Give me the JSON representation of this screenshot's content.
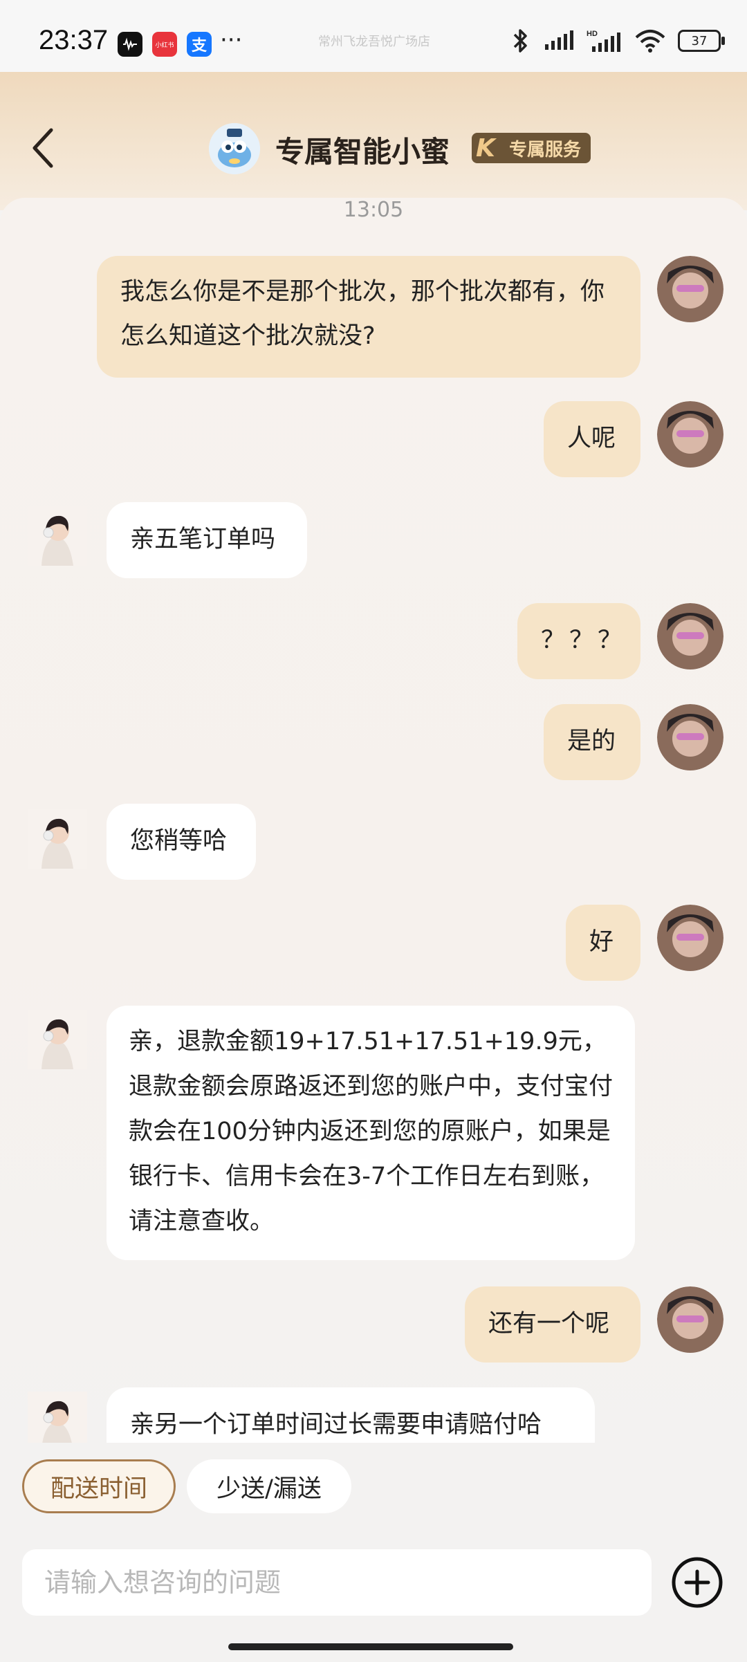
{
  "status_bar": {
    "time": "23:37",
    "app_icons": [
      {
        "name": "voice-recorder-icon",
        "color": "#111111",
        "label": ""
      },
      {
        "name": "xiaohongshu-icon",
        "color": "#e8343c",
        "label": "小红书"
      },
      {
        "name": "alipay-icon",
        "color": "#1677ff",
        "label": "支"
      }
    ],
    "more": "···",
    "overlay_text": "常州飞龙吾悦广场店",
    "battery": "37"
  },
  "header": {
    "title": "专属智能小蜜",
    "badge_text": "专属服务",
    "badge_logo": "K"
  },
  "chat": {
    "timestamp": "13:05",
    "messages": [
      {
        "role": "user",
        "text": "我怎么你是不是那个批次，那个批次都有，你怎么知道这个批次就没?"
      },
      {
        "role": "user",
        "text": "人呢"
      },
      {
        "role": "agent",
        "text": "亲五笔订单吗"
      },
      {
        "role": "user",
        "text": "？？？"
      },
      {
        "role": "user",
        "text": "是的"
      },
      {
        "role": "agent",
        "text": "您稍等哈"
      },
      {
        "role": "user",
        "text": "好"
      },
      {
        "role": "agent",
        "text": "亲，退款金额19+17.51+17.51+19.9元，退款金额会原路返还到您的账户中，支付宝付款会在100分钟内返还到您的原账户，如果是银行卡、信用卡会在3-7个工作日左右到账，请注意查收。"
      },
      {
        "role": "user",
        "text": "还有一个呢"
      },
      {
        "role": "agent",
        "text": "亲另一个订单时间过长需要申请赔付哈"
      }
    ]
  },
  "quick_actions": [
    {
      "label": "配送时间"
    },
    {
      "label": "少送/漏送"
    }
  ],
  "input": {
    "placeholder": "请输入想咨询的问题"
  },
  "colors": {
    "user_bubble": "#f6e4c8",
    "agent_bubble": "#ffffff",
    "accent": "#a87d4f"
  }
}
